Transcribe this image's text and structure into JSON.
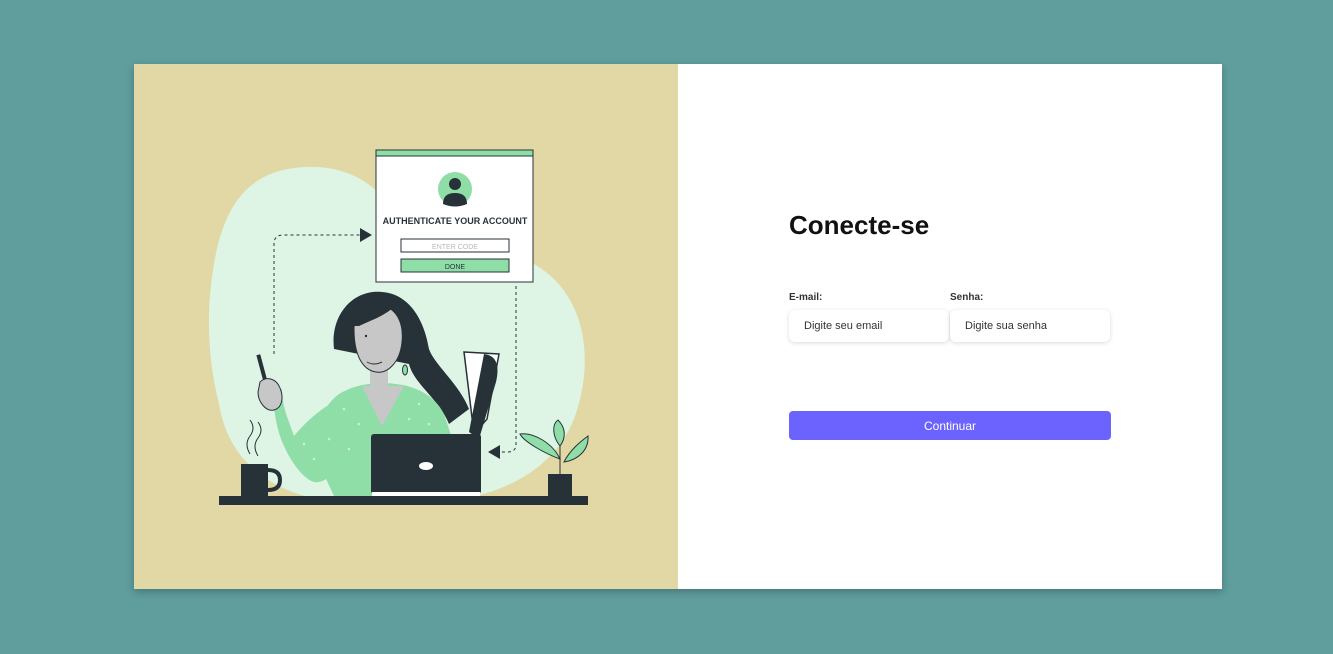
{
  "illustration": {
    "dialog_title": "AUTHENTICATE YOUR ACCOUNT",
    "code_placeholder": "ENTER CODE",
    "done_label": "DONE"
  },
  "login": {
    "title": "Conecte-se",
    "email_label": "E-mail:",
    "email_placeholder": "Digite seu email",
    "password_label": "Senha:",
    "password_placeholder": "Digite sua senha",
    "submit_label": "Continuar"
  },
  "colors": {
    "page_background": "#609e9e",
    "illustration_background": "#e2d8a5",
    "accent": "#6c63ff",
    "illustration_green": "#8fdea8",
    "illustration_dark": "#263238"
  }
}
